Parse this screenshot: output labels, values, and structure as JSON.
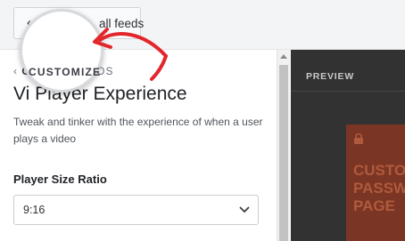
{
  "topbar": {
    "back_label": "all feeds"
  },
  "panel": {
    "breadcrumb_strong": "CUSTOMIZE",
    "breadcrumb_tail": "OS",
    "title": "Player Experience",
    "title_prefix": "Vi",
    "description": "Tweak and tinker with the experience of when a user plays a video",
    "field_label": "Player Size Ratio",
    "select_value": "9:16"
  },
  "preview": {
    "label": "PREVIEW",
    "video_text": "CUSTO\nPASSW\nPAGE"
  },
  "colors": {
    "annotation_arrow": "#e3262b",
    "video_bg": "#7a3524"
  }
}
